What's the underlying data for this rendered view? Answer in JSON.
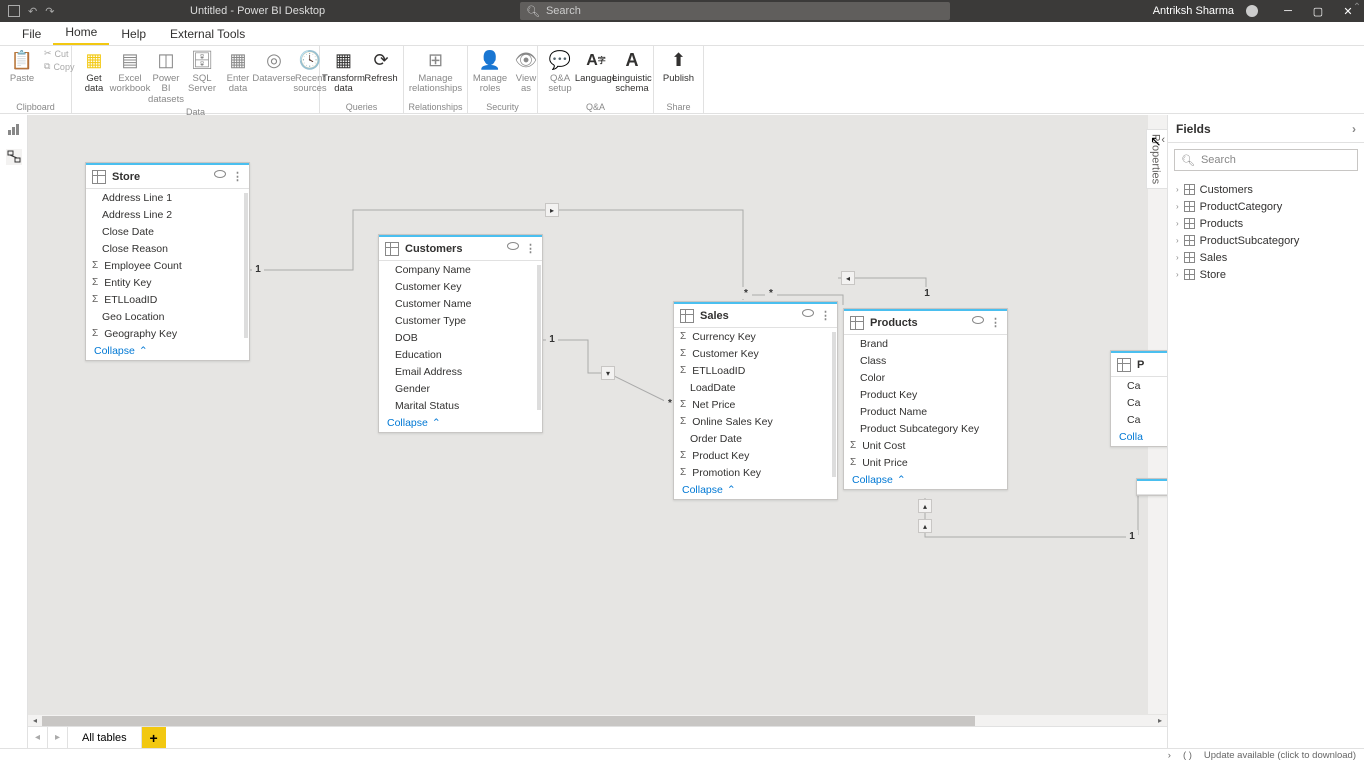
{
  "window": {
    "title": "Untitled - Power BI Desktop",
    "user": "Antriksh Sharma",
    "search_placeholder": "Search"
  },
  "menu": {
    "file": "File",
    "home": "Home",
    "help": "Help",
    "external_tools": "External Tools"
  },
  "ribbon": {
    "paste": "Paste",
    "cut": "Cut",
    "copy": "Copy",
    "get_data": "Get\ndata",
    "excel_wb": "Excel\nworkbook",
    "pbi_ds": "Power BI\ndatasets",
    "sql": "SQL\nServer",
    "enter": "Enter\ndata",
    "dataverse": "Dataverse",
    "recent": "Recent\nsources",
    "transform": "Transform\ndata",
    "refresh": "Refresh",
    "manage_rel": "Manage\nrelationships",
    "manage_roles": "Manage\nroles",
    "view_as": "View\nas",
    "qa_setup": "Q&A\nsetup",
    "language": "Language",
    "linguistic": "Linguistic\nschema",
    "publish": "Publish",
    "g_clipboard": "Clipboard",
    "g_data": "Data",
    "g_queries": "Queries",
    "g_relationships": "Relationships",
    "g_security": "Security",
    "g_qa": "Q&A",
    "g_share": "Share"
  },
  "tables": {
    "store": {
      "name": "Store",
      "fields": [
        "Address Line 1",
        "Address Line 2",
        "Close Date",
        "Close Reason",
        "Employee Count",
        "Entity Key",
        "ETLLoadID",
        "Geo Location",
        "Geography Key"
      ],
      "sigma_idx": [
        4,
        5,
        6,
        8
      ],
      "collapse": "Collapse"
    },
    "customers": {
      "name": "Customers",
      "fields": [
        "Company Name",
        "Customer Key",
        "Customer Name",
        "Customer Type",
        "DOB",
        "Education",
        "Email Address",
        "Gender",
        "Marital Status"
      ],
      "sigma_idx": [],
      "collapse": "Collapse"
    },
    "sales": {
      "name": "Sales",
      "fields": [
        "Currency Key",
        "Customer Key",
        "ETLLoadID",
        "LoadDate",
        "Net Price",
        "Online Sales Key",
        "Order Date",
        "Product Key",
        "Promotion Key"
      ],
      "sigma_idx": [
        0,
        1,
        2,
        4,
        5,
        7,
        8
      ],
      "collapse": "Collapse"
    },
    "products": {
      "name": "Products",
      "fields": [
        "Brand",
        "Class",
        "Color",
        "Product Key",
        "Product Name",
        "Product Subcategory Key",
        "Unit Cost",
        "Unit Price"
      ],
      "sigma_idx": [
        6,
        7
      ],
      "collapse": "Collapse"
    },
    "partial": {
      "name": "P",
      "fields": [
        "Ca",
        "Ca",
        "Ca"
      ],
      "collapse": "Colla"
    }
  },
  "fields_pane": {
    "title": "Fields",
    "search_placeholder": "Search",
    "items": [
      "Customers",
      "ProductCategory",
      "Products",
      "ProductSubcategory",
      "Sales",
      "Store"
    ]
  },
  "properties_label": "Properties",
  "tabs": {
    "all_tables": "All tables"
  },
  "status": {
    "update": "Update available (click to download)"
  },
  "rel_labels": {
    "one": "1",
    "many": "*"
  }
}
